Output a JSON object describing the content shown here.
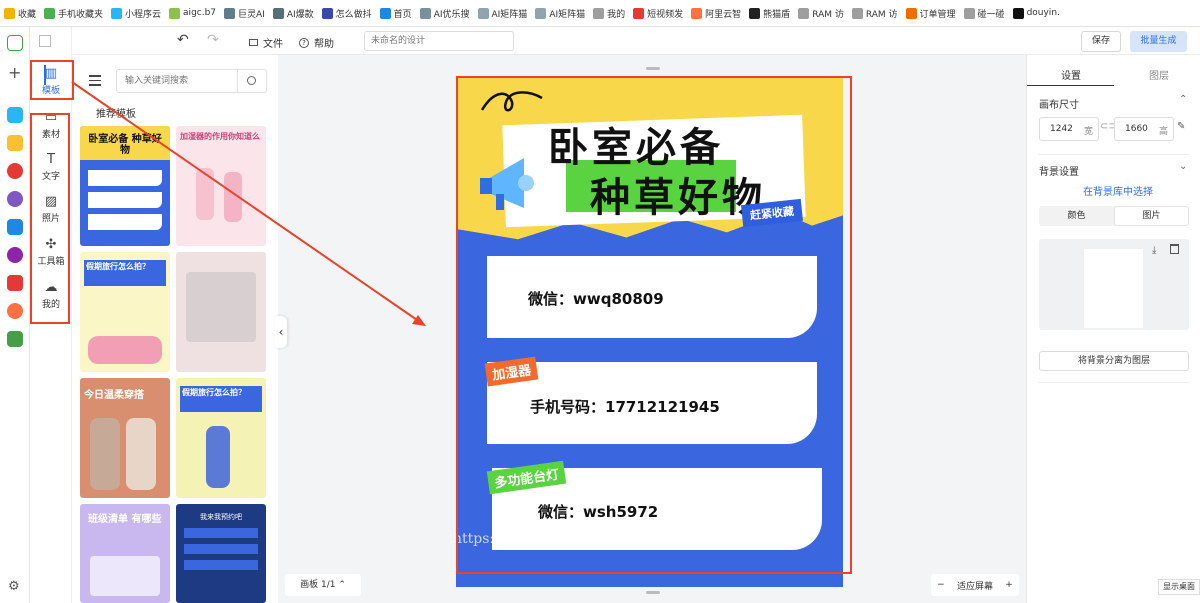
{
  "bookmarks": [
    {
      "label": "收藏",
      "color": "#f2b400"
    },
    {
      "label": "手机收藏夹",
      "color": "#4caf50"
    },
    {
      "label": "小程序云",
      "color": "#29b6f6"
    },
    {
      "label": "aigc.b7",
      "color": "#8bc34a"
    },
    {
      "label": "巨灵AI",
      "color": "#607d8b"
    },
    {
      "label": "AI爆款",
      "color": "#546e7a"
    },
    {
      "label": "怎么做抖",
      "color": "#3949ab"
    },
    {
      "label": "首页",
      "color": "#1e88e5"
    },
    {
      "label": "AI优乐搜",
      "color": "#78909c"
    },
    {
      "label": "AI矩阵猫",
      "color": "#90a4ae"
    },
    {
      "label": "AI矩阵猫",
      "color": "#90a4ae"
    },
    {
      "label": "我的",
      "color": "#9e9e9e"
    },
    {
      "label": "短视频发",
      "color": "#e53935"
    },
    {
      "label": "阿里云智",
      "color": "#ff7043"
    },
    {
      "label": "熊猫盾",
      "color": "#212121"
    },
    {
      "label": "RAM 访",
      "color": "#9e9e9e"
    },
    {
      "label": "RAM 访",
      "color": "#9e9e9e"
    },
    {
      "label": "订单管理",
      "color": "#ef6c00"
    },
    {
      "label": "碰一碰",
      "color": "#9e9e9e"
    },
    {
      "label": "douyin.",
      "color": "#111111"
    }
  ],
  "topbar": {
    "undo": "↶",
    "redo": "↷",
    "file": "文件",
    "help": "帮助",
    "design_name_placeholder": "未命名的设计",
    "save": "保存",
    "batch": "批量生成"
  },
  "toolnav": {
    "template": "模板",
    "material": "素材",
    "text": "文字",
    "photo": "照片",
    "toolbox": "工具箱",
    "mine": "我的"
  },
  "panel": {
    "search_placeholder": "输入关键词搜索",
    "section_title": "推荐模板",
    "thumbs": [
      {
        "title": "卧室必备 种草好物"
      },
      {
        "title": "加湿器的作用你知道么"
      },
      {
        "title": "假期旅行怎么拍？"
      },
      {
        "title": ""
      },
      {
        "title": "今日温柔穿搭"
      },
      {
        "title": "假期旅行怎么拍？"
      },
      {
        "title": "班级清单 有哪些"
      },
      {
        "title": "我来我预约吧"
      }
    ],
    "collapse": "‹",
    "page_indicator": "画板 1/1"
  },
  "canvas_design": {
    "title_line1": "卧室必备",
    "title_line2": "种草好物",
    "ribbon": "赶紧收藏",
    "card1_text": "微信：wwq80809",
    "tag2": "加湿器",
    "card2_text": "手机号码：17712121945",
    "tag3": "多功能台灯",
    "card3_text": "微信：wsh5972",
    "watermark": "https://www.huzhan.com/ishop52814"
  },
  "zoom": {
    "minus": "−",
    "label": "适应屏幕",
    "plus": "+"
  },
  "right_panel": {
    "tab_settings": "设置",
    "tab_layers": "图层",
    "canvas_size": "画布尺寸",
    "width": "1242",
    "width_unit": "宽",
    "height": "1660",
    "height_unit": "高",
    "bg_settings": "背景设置",
    "bg_library": "在背景库中选择",
    "color_tab": "颜色",
    "image_tab": "图片",
    "separate": "将背景分离为图层"
  },
  "desktop_label": "显示桌面",
  "colors": {
    "accent": "#2d6cf0",
    "canvas_blue": "#3a66e0",
    "yellow": "#f8d84a",
    "green": "#59d33f",
    "orange": "#f36a2c",
    "red_annotation": "#e9432a"
  }
}
